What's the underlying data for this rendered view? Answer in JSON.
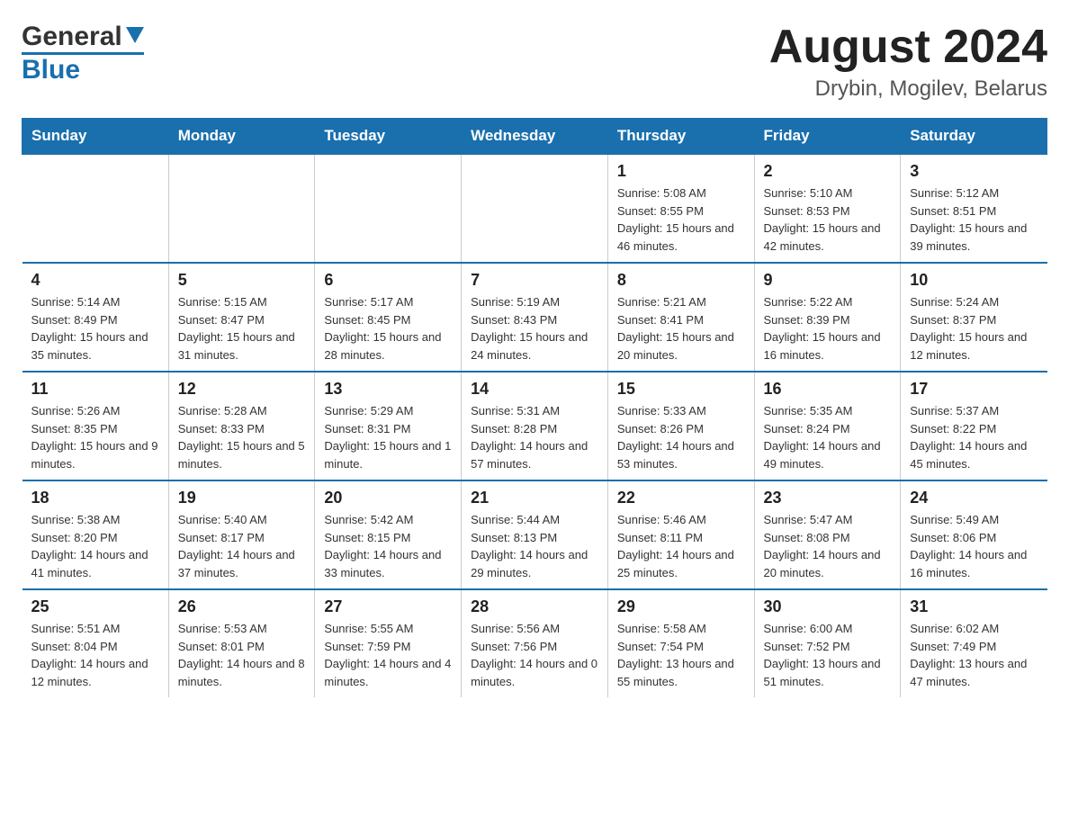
{
  "header": {
    "logo_general": "General",
    "logo_blue": "Blue",
    "month_title": "August 2024",
    "location": "Drybin, Mogilev, Belarus"
  },
  "days_of_week": [
    "Sunday",
    "Monday",
    "Tuesday",
    "Wednesday",
    "Thursday",
    "Friday",
    "Saturday"
  ],
  "weeks": [
    {
      "days": [
        {
          "num": "",
          "info": ""
        },
        {
          "num": "",
          "info": ""
        },
        {
          "num": "",
          "info": ""
        },
        {
          "num": "",
          "info": ""
        },
        {
          "num": "1",
          "info": "Sunrise: 5:08 AM\nSunset: 8:55 PM\nDaylight: 15 hours and 46 minutes."
        },
        {
          "num": "2",
          "info": "Sunrise: 5:10 AM\nSunset: 8:53 PM\nDaylight: 15 hours and 42 minutes."
        },
        {
          "num": "3",
          "info": "Sunrise: 5:12 AM\nSunset: 8:51 PM\nDaylight: 15 hours and 39 minutes."
        }
      ]
    },
    {
      "days": [
        {
          "num": "4",
          "info": "Sunrise: 5:14 AM\nSunset: 8:49 PM\nDaylight: 15 hours and 35 minutes."
        },
        {
          "num": "5",
          "info": "Sunrise: 5:15 AM\nSunset: 8:47 PM\nDaylight: 15 hours and 31 minutes."
        },
        {
          "num": "6",
          "info": "Sunrise: 5:17 AM\nSunset: 8:45 PM\nDaylight: 15 hours and 28 minutes."
        },
        {
          "num": "7",
          "info": "Sunrise: 5:19 AM\nSunset: 8:43 PM\nDaylight: 15 hours and 24 minutes."
        },
        {
          "num": "8",
          "info": "Sunrise: 5:21 AM\nSunset: 8:41 PM\nDaylight: 15 hours and 20 minutes."
        },
        {
          "num": "9",
          "info": "Sunrise: 5:22 AM\nSunset: 8:39 PM\nDaylight: 15 hours and 16 minutes."
        },
        {
          "num": "10",
          "info": "Sunrise: 5:24 AM\nSunset: 8:37 PM\nDaylight: 15 hours and 12 minutes."
        }
      ]
    },
    {
      "days": [
        {
          "num": "11",
          "info": "Sunrise: 5:26 AM\nSunset: 8:35 PM\nDaylight: 15 hours and 9 minutes."
        },
        {
          "num": "12",
          "info": "Sunrise: 5:28 AM\nSunset: 8:33 PM\nDaylight: 15 hours and 5 minutes."
        },
        {
          "num": "13",
          "info": "Sunrise: 5:29 AM\nSunset: 8:31 PM\nDaylight: 15 hours and 1 minute."
        },
        {
          "num": "14",
          "info": "Sunrise: 5:31 AM\nSunset: 8:28 PM\nDaylight: 14 hours and 57 minutes."
        },
        {
          "num": "15",
          "info": "Sunrise: 5:33 AM\nSunset: 8:26 PM\nDaylight: 14 hours and 53 minutes."
        },
        {
          "num": "16",
          "info": "Sunrise: 5:35 AM\nSunset: 8:24 PM\nDaylight: 14 hours and 49 minutes."
        },
        {
          "num": "17",
          "info": "Sunrise: 5:37 AM\nSunset: 8:22 PM\nDaylight: 14 hours and 45 minutes."
        }
      ]
    },
    {
      "days": [
        {
          "num": "18",
          "info": "Sunrise: 5:38 AM\nSunset: 8:20 PM\nDaylight: 14 hours and 41 minutes."
        },
        {
          "num": "19",
          "info": "Sunrise: 5:40 AM\nSunset: 8:17 PM\nDaylight: 14 hours and 37 minutes."
        },
        {
          "num": "20",
          "info": "Sunrise: 5:42 AM\nSunset: 8:15 PM\nDaylight: 14 hours and 33 minutes."
        },
        {
          "num": "21",
          "info": "Sunrise: 5:44 AM\nSunset: 8:13 PM\nDaylight: 14 hours and 29 minutes."
        },
        {
          "num": "22",
          "info": "Sunrise: 5:46 AM\nSunset: 8:11 PM\nDaylight: 14 hours and 25 minutes."
        },
        {
          "num": "23",
          "info": "Sunrise: 5:47 AM\nSunset: 8:08 PM\nDaylight: 14 hours and 20 minutes."
        },
        {
          "num": "24",
          "info": "Sunrise: 5:49 AM\nSunset: 8:06 PM\nDaylight: 14 hours and 16 minutes."
        }
      ]
    },
    {
      "days": [
        {
          "num": "25",
          "info": "Sunrise: 5:51 AM\nSunset: 8:04 PM\nDaylight: 14 hours and 12 minutes."
        },
        {
          "num": "26",
          "info": "Sunrise: 5:53 AM\nSunset: 8:01 PM\nDaylight: 14 hours and 8 minutes."
        },
        {
          "num": "27",
          "info": "Sunrise: 5:55 AM\nSunset: 7:59 PM\nDaylight: 14 hours and 4 minutes."
        },
        {
          "num": "28",
          "info": "Sunrise: 5:56 AM\nSunset: 7:56 PM\nDaylight: 14 hours and 0 minutes."
        },
        {
          "num": "29",
          "info": "Sunrise: 5:58 AM\nSunset: 7:54 PM\nDaylight: 13 hours and 55 minutes."
        },
        {
          "num": "30",
          "info": "Sunrise: 6:00 AM\nSunset: 7:52 PM\nDaylight: 13 hours and 51 minutes."
        },
        {
          "num": "31",
          "info": "Sunrise: 6:02 AM\nSunset: 7:49 PM\nDaylight: 13 hours and 47 minutes."
        }
      ]
    }
  ]
}
